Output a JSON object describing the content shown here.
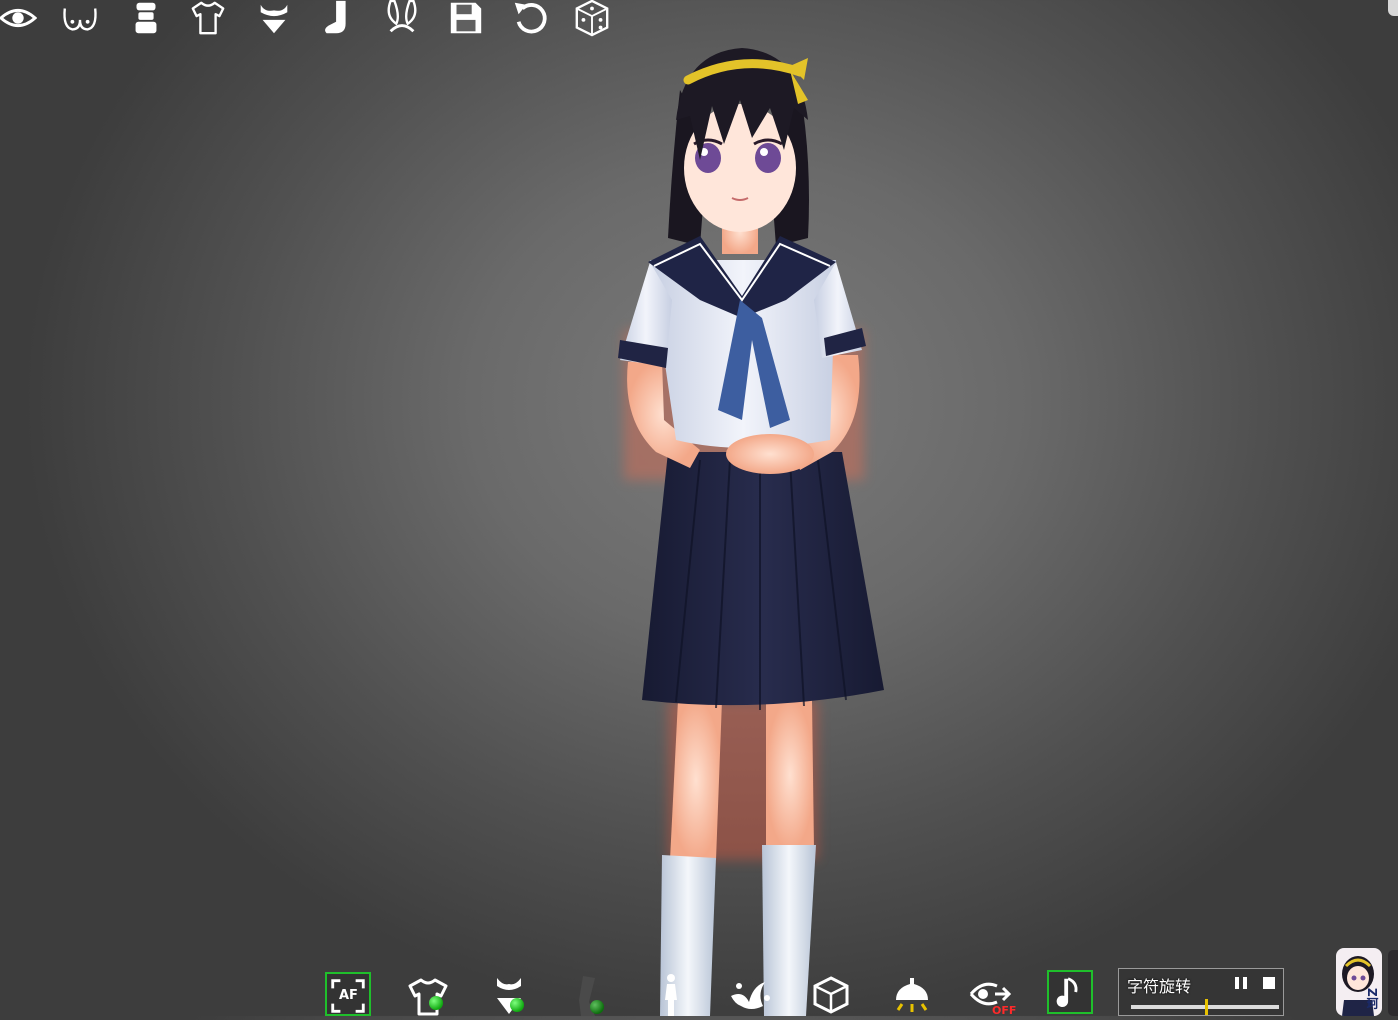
{
  "toolbar_top": {
    "icons": [
      {
        "name": "eye-icon"
      },
      {
        "name": "chest-icon"
      },
      {
        "name": "head-bust-icon"
      },
      {
        "name": "shirt-icon"
      },
      {
        "name": "bra-panties-icon"
      },
      {
        "name": "sock-icon"
      },
      {
        "name": "bunny-ears-icon"
      },
      {
        "name": "save-icon"
      },
      {
        "name": "undo-icon"
      },
      {
        "name": "dice-icon"
      }
    ]
  },
  "toolbar_bottom": {
    "buttons": [
      {
        "name": "autofocus-button",
        "label": "AF",
        "active": false
      },
      {
        "name": "clothes-toggle-button",
        "indicator": "on"
      },
      {
        "name": "underwear-toggle-button",
        "indicator": "on"
      },
      {
        "name": "leg-toggle-button",
        "indicator": "on"
      },
      {
        "name": "pose-button"
      },
      {
        "name": "splash-effect-button"
      },
      {
        "name": "room-cube-button"
      },
      {
        "name": "lamp-button"
      },
      {
        "name": "view-hide-button",
        "label": "OFF"
      },
      {
        "name": "music-button",
        "active": true
      }
    ]
  },
  "music_player": {
    "title": "字符旋转",
    "progress": 0.5
  },
  "avatar": {
    "badge_text": "Z珂"
  },
  "colors": {
    "accent_green": "#1fbf2b",
    "progress_knob": "#e8c200",
    "icon_white": "#ffffff"
  }
}
